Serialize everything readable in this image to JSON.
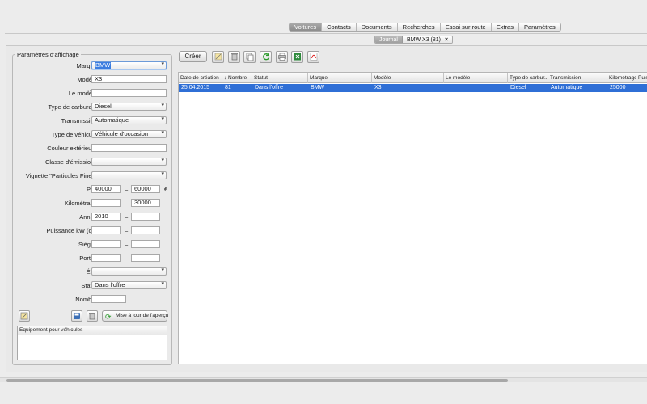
{
  "nav": {
    "tabs": [
      "Voitures",
      "Contacts",
      "Documents",
      "Recherches",
      "Essai sur route",
      "Extras",
      "Paramètres"
    ],
    "active": "Voitures"
  },
  "subtabs": {
    "journal": "Journal",
    "current": "BMW X3 (81)",
    "close": "×"
  },
  "params": {
    "title": "Paramètres d'affichage",
    "marque": {
      "label": "Marque:",
      "value": "BMW"
    },
    "modele": {
      "label": "Modèle:",
      "value": "X3"
    },
    "le_modele": {
      "label": "Le modèle:",
      "value": ""
    },
    "carburant": {
      "label": "Type de carburant:",
      "value": "Diesel"
    },
    "transmission": {
      "label": "Transmission:",
      "value": "Automatique"
    },
    "vehicule": {
      "label": "Type de véhicule:",
      "value": "Véhicule d'occasion"
    },
    "couleur": {
      "label": "Couleur extérieure:",
      "value": ""
    },
    "emissions": {
      "label": "Classe d'émissions:",
      "value": ""
    },
    "vignette": {
      "label": "Vignette \"Particules Fines\":",
      "value": ""
    },
    "prix": {
      "label": "Prix:",
      "min": "40000",
      "max": "60000",
      "unit": "€"
    },
    "km": {
      "label": "Kilométrage:",
      "min": "",
      "max": "30000"
    },
    "annee": {
      "label": "Année:",
      "min": "2010",
      "max": ""
    },
    "puissance": {
      "label": "Puissance kW (ch):",
      "min": "",
      "max": ""
    },
    "sieges": {
      "label": "Sièges:",
      "min": "",
      "max": ""
    },
    "portes": {
      "label": "Portes:",
      "min": "",
      "max": ""
    },
    "etat": {
      "label": "État:",
      "value": ""
    },
    "statut": {
      "label": "Statut:",
      "value": "Dans l'offre"
    },
    "nombre": {
      "label": "Nombre:",
      "value": ""
    },
    "range_sep": "–",
    "update_label": "Mise à jour de l'aperçu",
    "equip_header": "Equipement pour véhicules"
  },
  "toolbar": {
    "create_label": "Créer"
  },
  "grid": {
    "columns": [
      "Date de création",
      "↓ Nombre",
      "Statut",
      "Marque",
      "Modèle",
      "Le modèle",
      "Type de carbur...",
      "Transmission",
      "Kilométrage",
      "Puis"
    ],
    "rows": [
      [
        "25.04.2015",
        "81",
        "Dans l'offre",
        "BMW",
        "X3",
        "",
        "Diesel",
        "Automatique",
        "25000",
        ""
      ]
    ]
  },
  "colors": {
    "selection": "#2f6fd6",
    "focus": "#3b7de0"
  }
}
